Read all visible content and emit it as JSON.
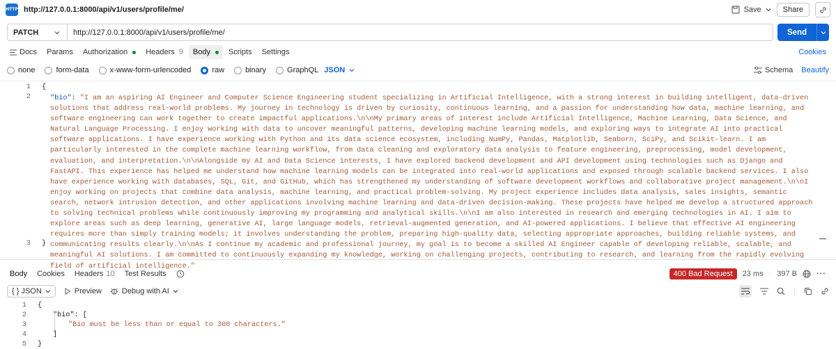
{
  "titlebar": {
    "badge": "HTTP",
    "url": "http://127.0.0.1:8000/api/v1/users/profile/me/",
    "save_label": "Save",
    "share_label": "Share"
  },
  "request": {
    "method": "PATCH",
    "url": "http://127.0.0.1:8000/api/v1/users/profile/me/",
    "send_label": "Send"
  },
  "tabs": {
    "docs": "Docs",
    "params": "Params",
    "authorization": "Authorization",
    "headers": "Headers",
    "headers_count": "9",
    "body": "Body",
    "scripts": "Scripts",
    "settings": "Settings",
    "cookies": "Cookies"
  },
  "body_types": {
    "none": "none",
    "form_data": "form-data",
    "urlencoded": "x-www-form-urlencoded",
    "raw": "raw",
    "binary": "binary",
    "graphql": "GraphQL",
    "format": "JSON",
    "schema": "Schema",
    "beautify": "Beautify"
  },
  "editor": {
    "line_numbers": [
      "1",
      "2",
      "3"
    ],
    "open_brace": "{",
    "close_brace": "}",
    "key": "\"bio\"",
    "colon": ": ",
    "bio_value": "\"I am an aspiring AI Engineer and Computer Science Engineering student specializing in Artificial Intelligence, with a strong interest in building intelligent, data-driven solutions that address real-world problems. My journey in technology is driven by curiosity, continuous learning, and a passion for understanding how data, machine learning, and software engineering can work together to create impactful applications.\\n\\nMy primary areas of interest include Artificial Intelligence, Machine Learning, Data Science, and Natural Language Processing. I enjoy working with data to uncover meaningful patterns, developing machine learning models, and exploring ways to integrate AI into practical software applications. I have experience working with Python and its data science ecosystem, including NumPy, Pandas, Matplotlib, Seaborn, SciPy, and Scikit-learn. I am particularly interested in the complete machine learning workflow, from data cleaning and exploratory data analysis to feature engineering, preprocessing, model development, evaluation, and interpretation.\\n\\nAlongside my AI and Data Science interests, I have explored backend development and API development using technologies such as Django and FastAPI. This experience has helped me understand how machine learning models can be integrated into real-world applications and exposed through scalable backend services. I also have experience working with databases, SQL, Git, and GitHub, which has strengthened my understanding of software development workflows and collaborative project management.\\n\\nI enjoy working on projects that combine data analysis, machine learning, and practical problem-solving. My project experience includes data analysis, sales insights, semantic search, network intrusion detection, and other applications involving machine learning and data-driven decision-making. These projects have helped me develop a structured approach to solving technical problems while continuously improving my programming and analytical skills.\\n\\nI am also interested in research and emerging technologies in AI. I aim to explore areas such as deep learning, generative AI, large language models, retrieval-augmented generation, and AI-powered applications. I believe that effective AI engineering requires more than simply training models; it involves understanding the problem, preparing high-quality data, selecting appropriate approaches, building reliable systems, and communicating results clearly.\\n\\nAs I continue my academic and professional journey, my goal is to become a skilled AI Engineer capable of developing reliable, scalable, and meaningful AI solutions. I am committed to continuously expanding my knowledge, working on challenging projects, contributing to research, and learning from the rapidly evolving field of artificial intelligence.\""
  },
  "response_tabs": {
    "body": "Body",
    "cookies": "Cookies",
    "headers": "Headers",
    "headers_count": "10",
    "test_results": "Test Results",
    "status": "400 Bad Request",
    "time": "23 ms",
    "size": "397 B"
  },
  "response_toolbar": {
    "format": "{ } JSON",
    "preview": "Preview",
    "debug": "Debug with AI"
  },
  "response": {
    "line_numbers": [
      "1",
      "2",
      "3",
      "4",
      "5"
    ],
    "open_brace": "{",
    "key_line": "\"bio\": [",
    "message": "\"Bio must be less than or equal to 300 characters.\"",
    "close_bracket": "]",
    "close_brace": "}"
  },
  "colors": {
    "accent": "#0f65d6",
    "error": "#c62828",
    "string": "#a35b3c",
    "key": "#1f57a8"
  }
}
